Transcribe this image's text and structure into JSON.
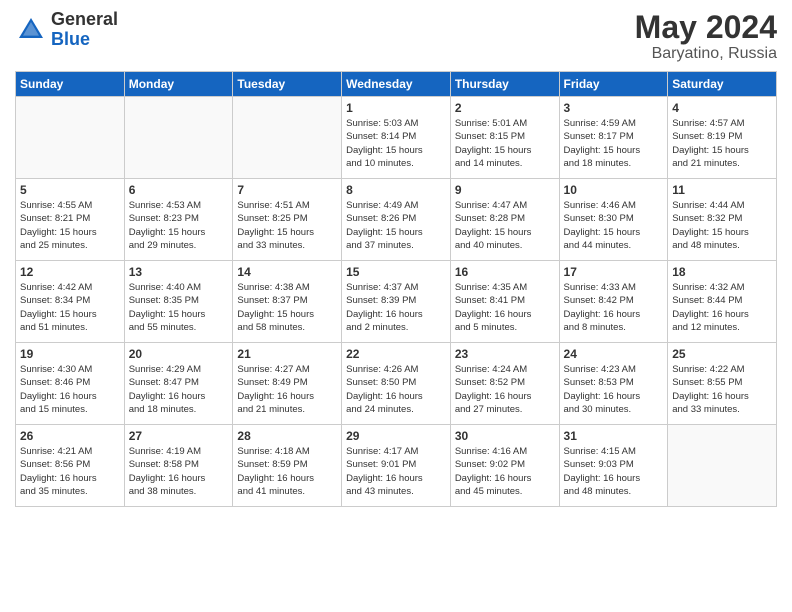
{
  "header": {
    "logo_general": "General",
    "logo_blue": "Blue",
    "month_year": "May 2024",
    "location": "Baryatino, Russia"
  },
  "weekdays": [
    "Sunday",
    "Monday",
    "Tuesday",
    "Wednesday",
    "Thursday",
    "Friday",
    "Saturday"
  ],
  "weeks": [
    {
      "days": [
        {
          "number": "",
          "info": ""
        },
        {
          "number": "",
          "info": ""
        },
        {
          "number": "",
          "info": ""
        },
        {
          "number": "1",
          "info": "Sunrise: 5:03 AM\nSunset: 8:14 PM\nDaylight: 15 hours\nand 10 minutes."
        },
        {
          "number": "2",
          "info": "Sunrise: 5:01 AM\nSunset: 8:15 PM\nDaylight: 15 hours\nand 14 minutes."
        },
        {
          "number": "3",
          "info": "Sunrise: 4:59 AM\nSunset: 8:17 PM\nDaylight: 15 hours\nand 18 minutes."
        },
        {
          "number": "4",
          "info": "Sunrise: 4:57 AM\nSunset: 8:19 PM\nDaylight: 15 hours\nand 21 minutes."
        }
      ]
    },
    {
      "days": [
        {
          "number": "5",
          "info": "Sunrise: 4:55 AM\nSunset: 8:21 PM\nDaylight: 15 hours\nand 25 minutes."
        },
        {
          "number": "6",
          "info": "Sunrise: 4:53 AM\nSunset: 8:23 PM\nDaylight: 15 hours\nand 29 minutes."
        },
        {
          "number": "7",
          "info": "Sunrise: 4:51 AM\nSunset: 8:25 PM\nDaylight: 15 hours\nand 33 minutes."
        },
        {
          "number": "8",
          "info": "Sunrise: 4:49 AM\nSunset: 8:26 PM\nDaylight: 15 hours\nand 37 minutes."
        },
        {
          "number": "9",
          "info": "Sunrise: 4:47 AM\nSunset: 8:28 PM\nDaylight: 15 hours\nand 40 minutes."
        },
        {
          "number": "10",
          "info": "Sunrise: 4:46 AM\nSunset: 8:30 PM\nDaylight: 15 hours\nand 44 minutes."
        },
        {
          "number": "11",
          "info": "Sunrise: 4:44 AM\nSunset: 8:32 PM\nDaylight: 15 hours\nand 48 minutes."
        }
      ]
    },
    {
      "days": [
        {
          "number": "12",
          "info": "Sunrise: 4:42 AM\nSunset: 8:34 PM\nDaylight: 15 hours\nand 51 minutes."
        },
        {
          "number": "13",
          "info": "Sunrise: 4:40 AM\nSunset: 8:35 PM\nDaylight: 15 hours\nand 55 minutes."
        },
        {
          "number": "14",
          "info": "Sunrise: 4:38 AM\nSunset: 8:37 PM\nDaylight: 15 hours\nand 58 minutes."
        },
        {
          "number": "15",
          "info": "Sunrise: 4:37 AM\nSunset: 8:39 PM\nDaylight: 16 hours\nand 2 minutes."
        },
        {
          "number": "16",
          "info": "Sunrise: 4:35 AM\nSunset: 8:41 PM\nDaylight: 16 hours\nand 5 minutes."
        },
        {
          "number": "17",
          "info": "Sunrise: 4:33 AM\nSunset: 8:42 PM\nDaylight: 16 hours\nand 8 minutes."
        },
        {
          "number": "18",
          "info": "Sunrise: 4:32 AM\nSunset: 8:44 PM\nDaylight: 16 hours\nand 12 minutes."
        }
      ]
    },
    {
      "days": [
        {
          "number": "19",
          "info": "Sunrise: 4:30 AM\nSunset: 8:46 PM\nDaylight: 16 hours\nand 15 minutes."
        },
        {
          "number": "20",
          "info": "Sunrise: 4:29 AM\nSunset: 8:47 PM\nDaylight: 16 hours\nand 18 minutes."
        },
        {
          "number": "21",
          "info": "Sunrise: 4:27 AM\nSunset: 8:49 PM\nDaylight: 16 hours\nand 21 minutes."
        },
        {
          "number": "22",
          "info": "Sunrise: 4:26 AM\nSunset: 8:50 PM\nDaylight: 16 hours\nand 24 minutes."
        },
        {
          "number": "23",
          "info": "Sunrise: 4:24 AM\nSunset: 8:52 PM\nDaylight: 16 hours\nand 27 minutes."
        },
        {
          "number": "24",
          "info": "Sunrise: 4:23 AM\nSunset: 8:53 PM\nDaylight: 16 hours\nand 30 minutes."
        },
        {
          "number": "25",
          "info": "Sunrise: 4:22 AM\nSunset: 8:55 PM\nDaylight: 16 hours\nand 33 minutes."
        }
      ]
    },
    {
      "days": [
        {
          "number": "26",
          "info": "Sunrise: 4:21 AM\nSunset: 8:56 PM\nDaylight: 16 hours\nand 35 minutes."
        },
        {
          "number": "27",
          "info": "Sunrise: 4:19 AM\nSunset: 8:58 PM\nDaylight: 16 hours\nand 38 minutes."
        },
        {
          "number": "28",
          "info": "Sunrise: 4:18 AM\nSunset: 8:59 PM\nDaylight: 16 hours\nand 41 minutes."
        },
        {
          "number": "29",
          "info": "Sunrise: 4:17 AM\nSunset: 9:01 PM\nDaylight: 16 hours\nand 43 minutes."
        },
        {
          "number": "30",
          "info": "Sunrise: 4:16 AM\nSunset: 9:02 PM\nDaylight: 16 hours\nand 45 minutes."
        },
        {
          "number": "31",
          "info": "Sunrise: 4:15 AM\nSunset: 9:03 PM\nDaylight: 16 hours\nand 48 minutes."
        },
        {
          "number": "",
          "info": ""
        }
      ]
    }
  ]
}
